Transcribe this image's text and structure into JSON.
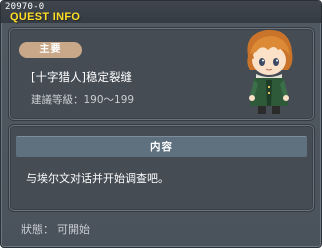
{
  "window": {
    "quest_id": "20970-0",
    "title": "QUEST INFO"
  },
  "quest": {
    "category": "主要",
    "name": "[十字猎人]稳定裂缝",
    "required_level": "建議等級：190～199"
  },
  "content": {
    "header": "内容",
    "text": "与埃尔文对话并开始调查吧。"
  },
  "status": {
    "label": "狀態：",
    "value": "可開始"
  },
  "npc": {
    "icon": "npc-portrait"
  },
  "colors": {
    "title": "#ffdf2a",
    "panel": "#454c54",
    "category_tag": "#c9a88a",
    "content_header": "#5f707f"
  }
}
